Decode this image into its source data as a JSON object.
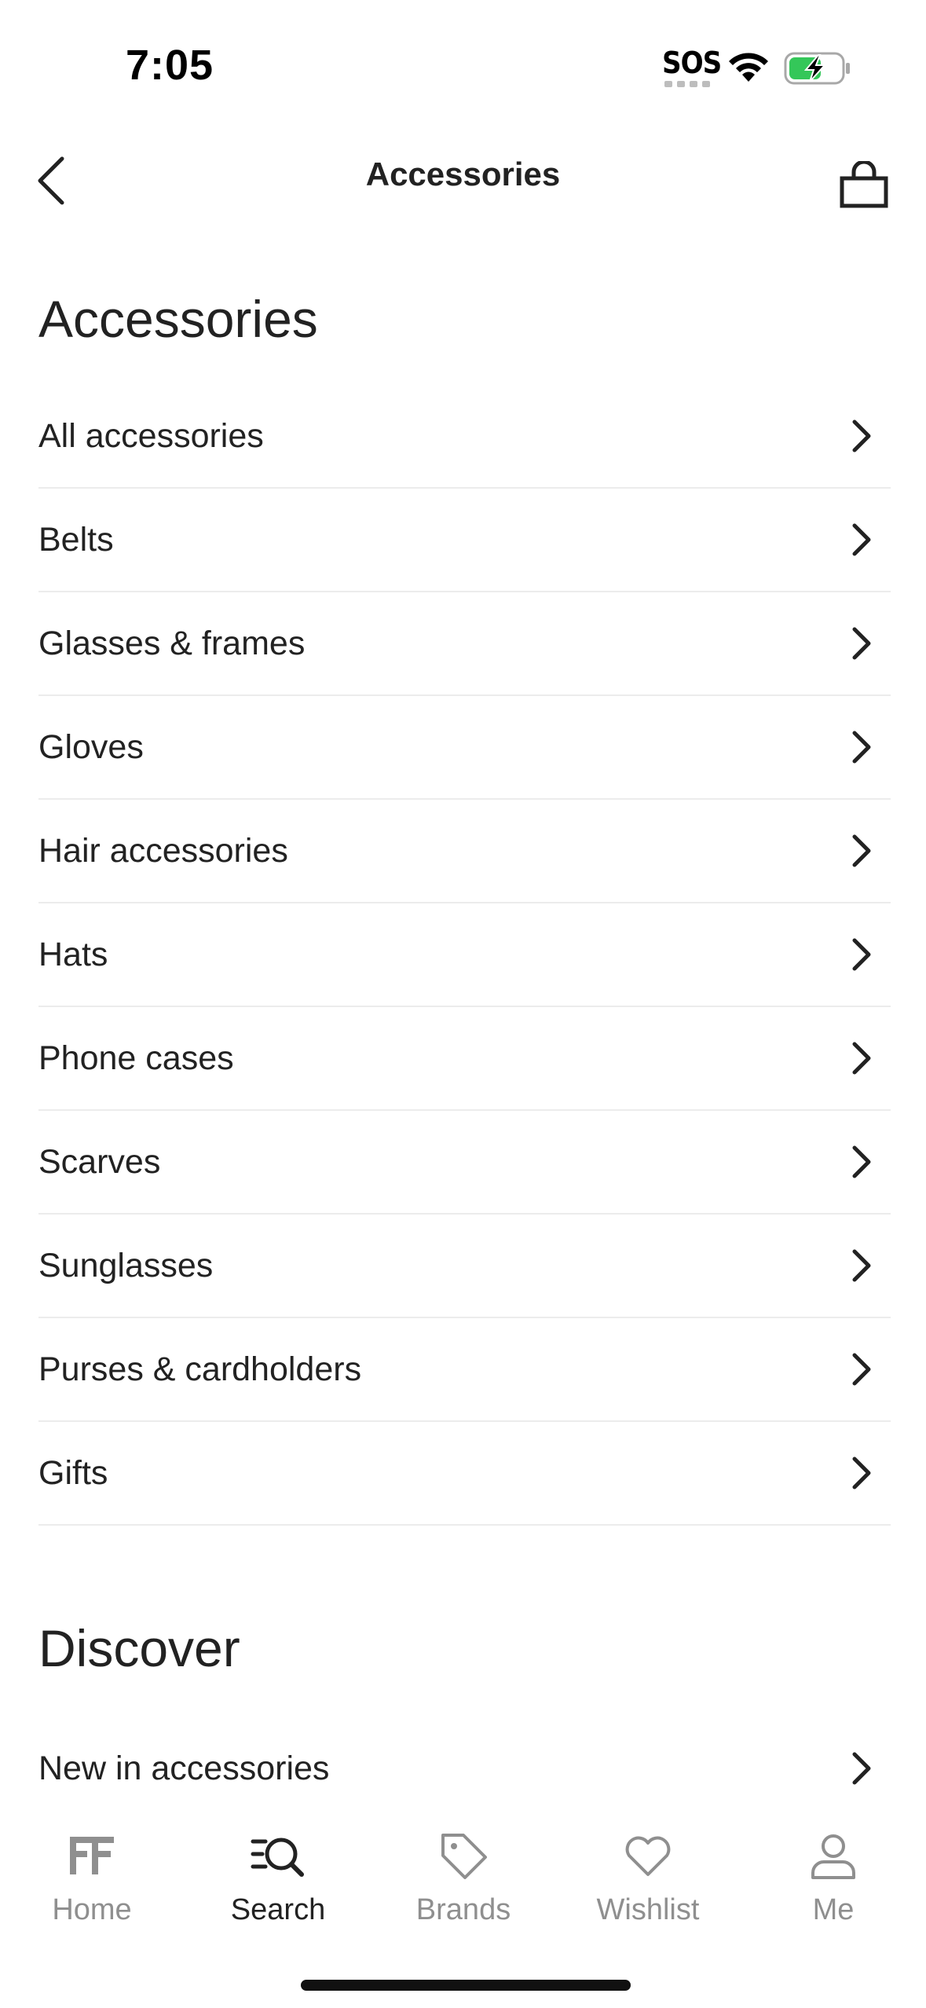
{
  "status_bar": {
    "time": "7:05",
    "sos": "SOS"
  },
  "nav": {
    "title": "Accessories"
  },
  "accessories_section": {
    "heading": "Accessories",
    "items": [
      {
        "label": "All accessories"
      },
      {
        "label": "Belts"
      },
      {
        "label": "Glasses & frames"
      },
      {
        "label": "Gloves"
      },
      {
        "label": "Hair accessories"
      },
      {
        "label": "Hats"
      },
      {
        "label": "Phone cases"
      },
      {
        "label": "Scarves"
      },
      {
        "label": "Sunglasses"
      },
      {
        "label": "Purses & cardholders"
      },
      {
        "label": "Gifts"
      }
    ]
  },
  "discover_section": {
    "heading": "Discover",
    "items": [
      {
        "label": "New in accessories"
      }
    ]
  },
  "tab_bar": {
    "tabs": [
      {
        "label": "Home",
        "icon": "ff-logo-icon",
        "active": false
      },
      {
        "label": "Search",
        "icon": "search-icon",
        "active": true
      },
      {
        "label": "Brands",
        "icon": "tag-icon",
        "active": false
      },
      {
        "label": "Wishlist",
        "icon": "heart-icon",
        "active": false
      },
      {
        "label": "Me",
        "icon": "person-icon",
        "active": false
      }
    ]
  },
  "colors": {
    "text": "#222222",
    "inactive_tab": "#8f8f8f",
    "divider": "#ececec",
    "battery_charge": "#34c759"
  }
}
